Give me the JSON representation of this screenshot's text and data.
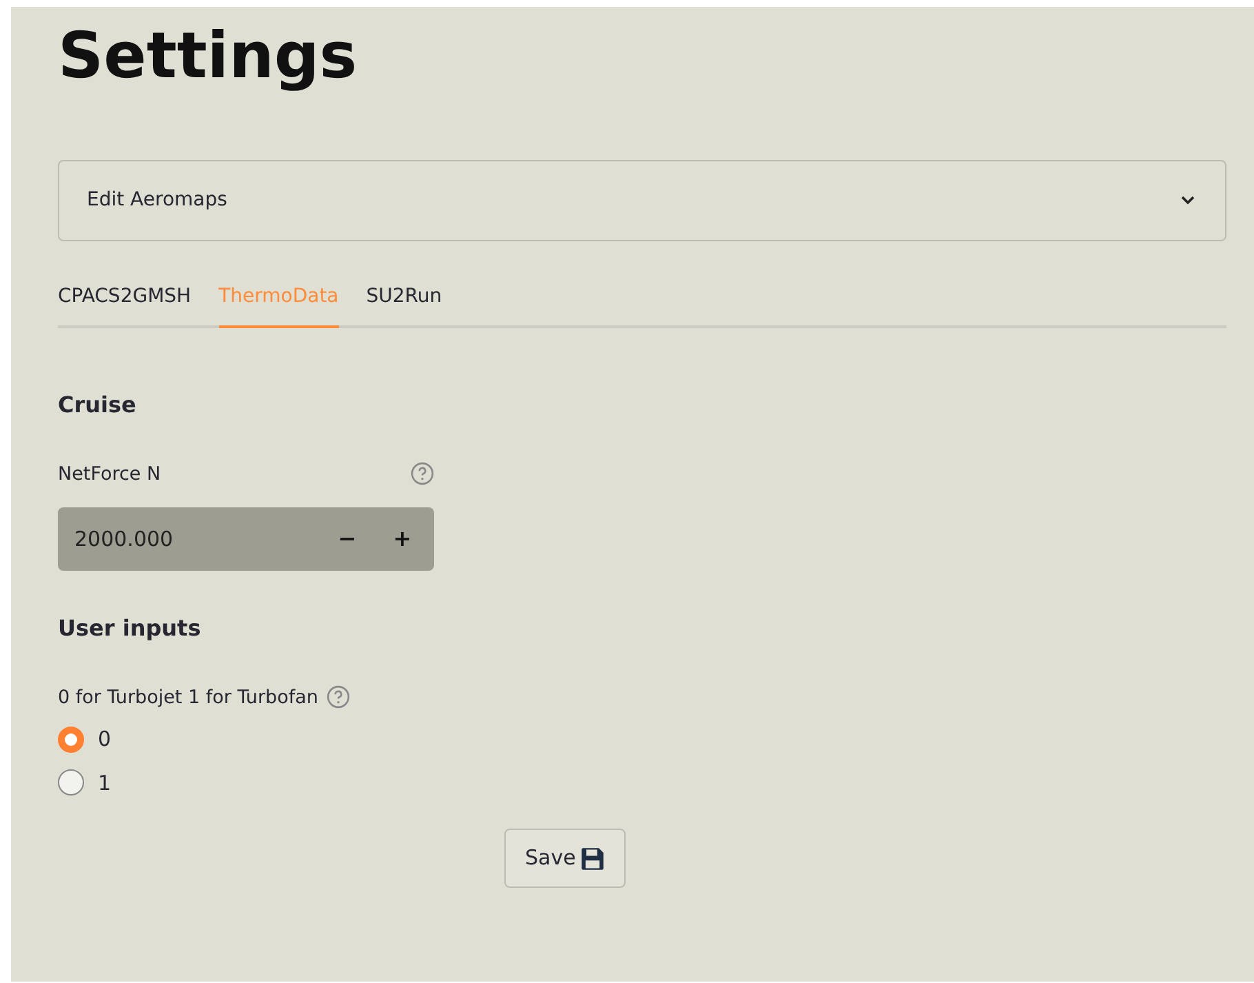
{
  "title": "Settings",
  "expander": {
    "label": "Edit Aeromaps",
    "expanded": false
  },
  "tabs": [
    {
      "label": "CPACS2GMSH",
      "selected": false
    },
    {
      "label": "ThermoData",
      "selected": true
    },
    {
      "label": "SU2Run",
      "selected": false
    }
  ],
  "sections": [
    {
      "heading": "Cruise",
      "kind": "number",
      "label": "NetForce N",
      "value": "2000.000",
      "decrement": "−",
      "increment": "+"
    },
    {
      "heading": "User inputs",
      "kind": "radio",
      "label": "0 for Turbojet 1 for Turbofan",
      "options": [
        {
          "label": "0",
          "selected": true
        },
        {
          "label": "1",
          "selected": false
        }
      ]
    }
  ],
  "save_button": {
    "label": "Save"
  }
}
